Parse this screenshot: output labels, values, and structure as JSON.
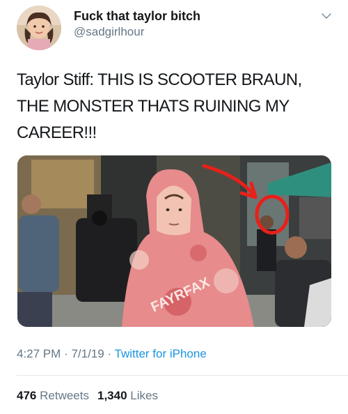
{
  "user": {
    "display_name": "Fuck that taylor bitch",
    "handle": "@sadgirlhour"
  },
  "tweet": {
    "text": "Taylor Stiff: THIS IS SCOOTER BRAUN, THE MONSTER THATS RUINING MY CAREER!!!",
    "time": "4:27 PM",
    "date": "7/1/19",
    "source": "Twitter for iPhone"
  },
  "stats": {
    "retweets_count": "476",
    "retweets_label": "Retweets",
    "likes_count": "1,340",
    "likes_label": "Likes"
  },
  "media": {
    "hoodie_text": "FAYRFAX"
  },
  "icons": {
    "chevron": "chevron-down-icon"
  },
  "colors": {
    "text": "#14171a",
    "secondary": "#657786",
    "link": "#1b95e0",
    "annotation": "#e8201a"
  }
}
